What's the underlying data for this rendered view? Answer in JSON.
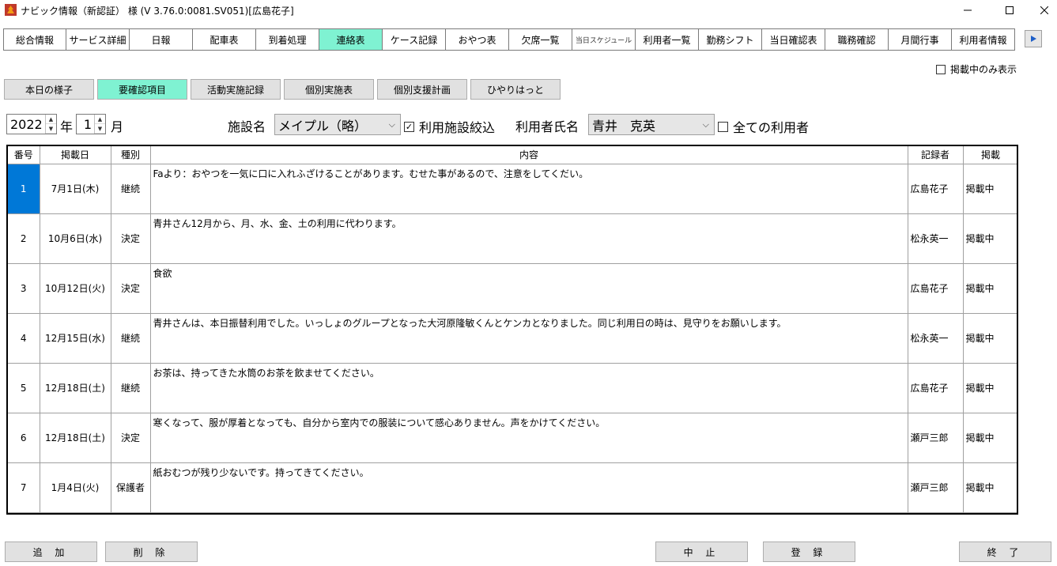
{
  "window": {
    "title": "ナビック情報（新認証） 様 (V 3.76.0:0081.SV051)[広島花子]"
  },
  "main_tabs": [
    {
      "label": "総合情報"
    },
    {
      "label": "サービス詳細"
    },
    {
      "label": "日報"
    },
    {
      "label": "配車表"
    },
    {
      "label": "到着処理"
    },
    {
      "label": "連絡表"
    },
    {
      "label": "ケース記録"
    },
    {
      "label": "おやつ表"
    },
    {
      "label": "欠席一覧"
    },
    {
      "label": "当日スケジュール"
    },
    {
      "label": "利用者一覧"
    },
    {
      "label": "勤務シフト"
    },
    {
      "label": "当日確認表"
    },
    {
      "label": "職務確認"
    },
    {
      "label": "月間行事"
    },
    {
      "label": "利用者情報"
    }
  ],
  "show_posted_only": {
    "label": "掲載中のみ表示",
    "checked": false
  },
  "sub_tabs": [
    {
      "label": "本日の様子"
    },
    {
      "label": "要確認項目"
    },
    {
      "label": "活動実施記録"
    },
    {
      "label": "個別実施表"
    },
    {
      "label": "個別支援計画"
    },
    {
      "label": "ひやりはっと"
    }
  ],
  "filters": {
    "year": "2022",
    "year_unit": "年",
    "month": "1",
    "month_unit": "月",
    "facility_label": "施設名",
    "facility_value": "メイプル（略）",
    "narrow_label": "利用施設絞込",
    "narrow_checked": true,
    "user_label": "利用者氏名",
    "user_value": "青井　克英",
    "all_users_label": "全ての利用者",
    "all_users_checked": false
  },
  "table": {
    "headers": [
      "番号",
      "掲載日",
      "種別",
      "内容",
      "記録者",
      "掲載"
    ],
    "rows": [
      {
        "no": "1",
        "date": "7月1日(木)",
        "type": "継続",
        "content": "Faより：おやつを一気に口に入れふざけることがあります。むせた事があるので、注意をしてくだい。",
        "recorder": "広島花子",
        "status": "掲載中"
      },
      {
        "no": "2",
        "date": "10月6日(水)",
        "type": "決定",
        "content": "青井さん12月から、月、水、金、土の利用に代わります。",
        "recorder": "松永英一",
        "status": "掲載中"
      },
      {
        "no": "3",
        "date": "10月12日(火)",
        "type": "決定",
        "content": "食欲",
        "recorder": "広島花子",
        "status": "掲載中"
      },
      {
        "no": "4",
        "date": "12月15日(水)",
        "type": "継続",
        "content": "青井さんは、本日振替利用でした。いっしょのグループとなった大河原隆敏くんとケンカとなりました。同じ利用日の時は、見守りをお願いします。",
        "recorder": "松永英一",
        "status": "掲載中"
      },
      {
        "no": "5",
        "date": "12月18日(土)",
        "type": "継続",
        "content": "お茶は、持ってきた水筒のお茶を飲ませてください。",
        "recorder": "広島花子",
        "status": "掲載中"
      },
      {
        "no": "6",
        "date": "12月18日(土)",
        "type": "決定",
        "content": "寒くなって、服が厚着となっても、自分から室内での服装について感心ありません。声をかけてください。",
        "recorder": "瀬戸三郎",
        "status": "掲載中"
      },
      {
        "no": "7",
        "date": "1月4日(火)",
        "type": "保護者",
        "content": "紙おむつが残り少ないです。持ってきてください。",
        "recorder": "瀬戸三郎",
        "status": "掲載中"
      }
    ]
  },
  "buttons": {
    "add": "追 加",
    "delete": "削 除",
    "cancel": "中 止",
    "register": "登 録",
    "exit": "終 了"
  },
  "colors": {
    "active_tab": "#7ff2d2",
    "selection": "#0078d7"
  }
}
